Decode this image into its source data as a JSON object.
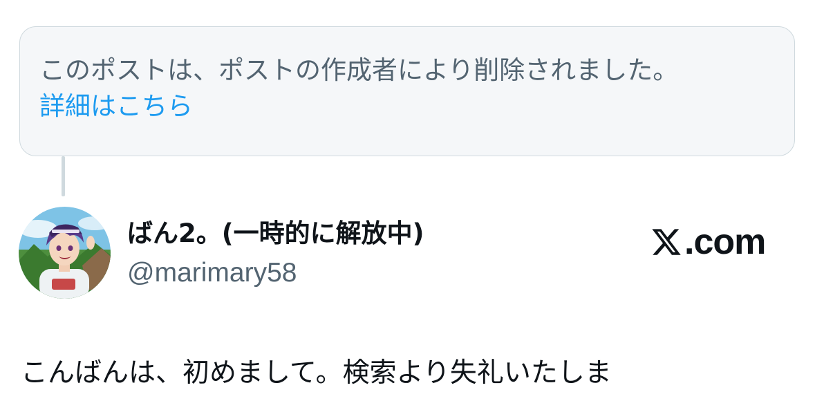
{
  "deleted_notice": {
    "message": "このポストは、ポストの作成者により削除されました。",
    "learn_more": "詳細はこちら"
  },
  "author": {
    "display_name": "ばん2。(一時的に解放中)",
    "handle": "@marimary58"
  },
  "brand": {
    "label": ".com",
    "icon": "x-logo-icon"
  },
  "post": {
    "text": "こんばんは、初めまして。検索より失礼いたしま"
  },
  "colors": {
    "card_bg": "#f5f7f9",
    "card_border": "#cfd9de",
    "secondary_text": "#536471",
    "link": "#1d9bf0",
    "primary_text": "#0f1419"
  }
}
